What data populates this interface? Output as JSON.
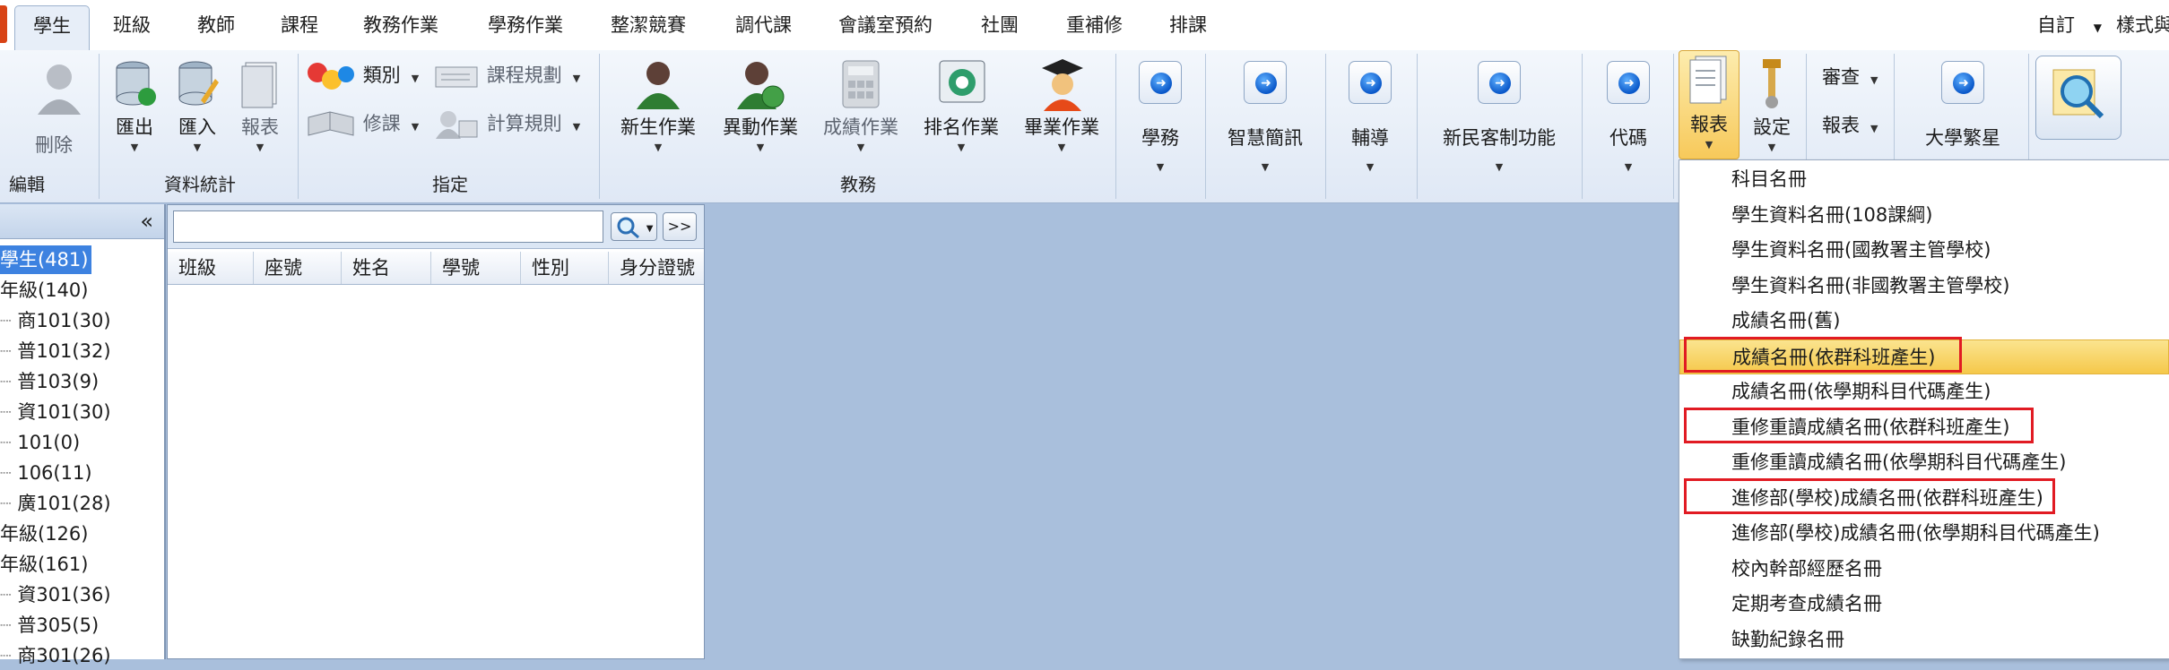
{
  "menu": {
    "tabs": [
      "學生",
      "班級",
      "教師",
      "課程",
      "教務作業",
      "學務作業",
      "整潔競賽",
      "調代課",
      "會議室預約",
      "社團",
      "重補修",
      "排課"
    ],
    "active_tab": "學生",
    "right_custom": "自訂",
    "right_style": "樣式與"
  },
  "ribbon": {
    "edit_group": {
      "delete_label": "刪除",
      "group_label": "編輯"
    },
    "stats_group": {
      "export_label": "匯出",
      "import_label": "匯入",
      "report_label": "報表",
      "group_label": "資料統計"
    },
    "assign_group": {
      "category_label": "類別",
      "course_plan_label": "課程規劃",
      "repair_label": "修課",
      "calc_rule_label": "計算規則",
      "group_label": "指定"
    },
    "academic_group": {
      "new_student_label": "新生作業",
      "transfer_label": "異動作業",
      "grade_label": "成績作業",
      "ranking_label": "排名作業",
      "graduation_label": "畢業作業",
      "group_label": "教務"
    },
    "extra_buttons": {
      "student_affairs": "學務",
      "smart_info": "智慧簡訊",
      "counseling": "輔導",
      "new_system": "新民客制功能",
      "code": "代碼"
    },
    "right_group": {
      "report_label": "報表",
      "settings_label": "設定",
      "review_label": "審查",
      "report2_label": "報表",
      "university_label": "大學繁星",
      "query_label": "查詢"
    }
  },
  "tree": {
    "root": "學生(481)",
    "items": [
      {
        "label": "年級(140)",
        "indent": 0
      },
      {
        "label": "商101(30)",
        "indent": 1
      },
      {
        "label": "普101(32)",
        "indent": 1
      },
      {
        "label": "普103(9)",
        "indent": 1
      },
      {
        "label": "資101(30)",
        "indent": 1
      },
      {
        "label": "101(0)",
        "indent": 1
      },
      {
        "label": "106(11)",
        "indent": 1
      },
      {
        "label": "廣101(28)",
        "indent": 1
      },
      {
        "label": "年級(126)",
        "indent": 0
      },
      {
        "label": "年級(161)",
        "indent": 0
      },
      {
        "label": "資301(36)",
        "indent": 1
      },
      {
        "label": "普305(5)",
        "indent": 1
      },
      {
        "label": "商301(26)",
        "indent": 1
      }
    ],
    "collapse_glyph": "«"
  },
  "list": {
    "search_value": "",
    "next_label": ">>",
    "columns": [
      "班級",
      "座號",
      "姓名",
      "學號",
      "性別",
      "身分證號"
    ]
  },
  "dropdown": {
    "items": [
      "科目名冊",
      "學生資料名冊(108課綱)",
      "學生資料名冊(國教署主管學校)",
      "學生資料名冊(非國教署主管學校)",
      "成績名冊(舊)",
      "成績名冊(依群科班產生)",
      "成績名冊(依學期科目代碼產生)",
      "重修重讀成績名冊(依群科班產生)",
      "重修重讀成績名冊(依學期科目代碼產生)",
      "進修部(學校)成績名冊(依群科班產生)",
      "進修部(學校)成績名冊(依學期科目代碼產生)",
      "校內幹部經歷名冊",
      "定期考查成績名冊",
      "缺勤紀錄名冊"
    ],
    "highlighted_index": 5,
    "red_boxed_indices": [
      5,
      7,
      9
    ]
  },
  "colors": {
    "app_background": "#a9bfdc",
    "selection_blue": "#3d82e0",
    "highlight_gold": "#f5c84a",
    "annotation_red": "#e11b23"
  }
}
